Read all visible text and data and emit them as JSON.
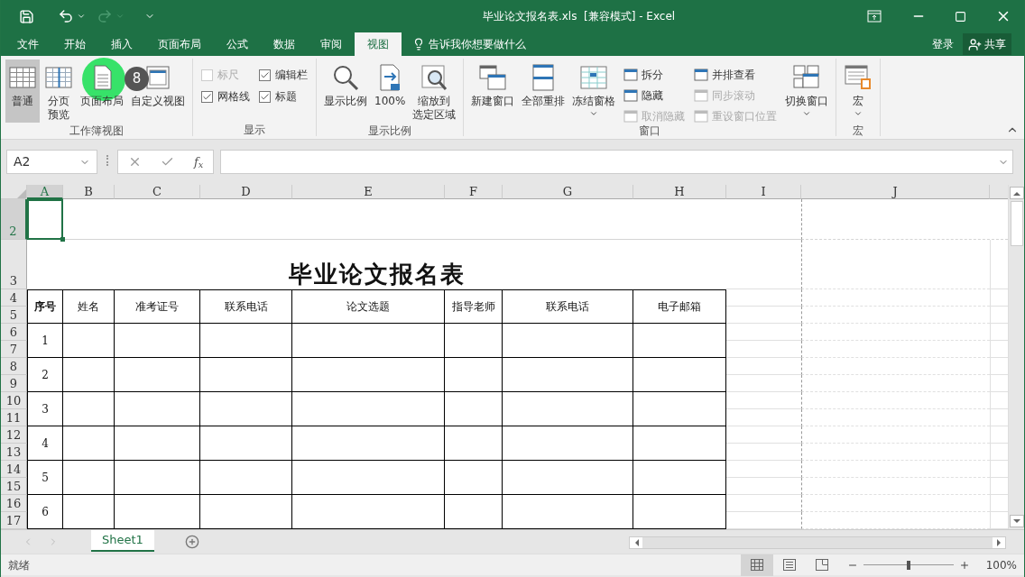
{
  "window": {
    "title": "毕业论文报名表.xls  [兼容模式] - Excel"
  },
  "tabs": [
    {
      "label": "文件",
      "selected": false
    },
    {
      "label": "开始",
      "selected": false
    },
    {
      "label": "插入",
      "selected": false
    },
    {
      "label": "页面布局",
      "selected": false
    },
    {
      "label": "公式",
      "selected": false
    },
    {
      "label": "数据",
      "selected": false
    },
    {
      "label": "审阅",
      "selected": false
    },
    {
      "label": "视图",
      "selected": true
    }
  ],
  "tell_me": "告诉我你想要做什么",
  "account": {
    "sign_in": "登录",
    "share": "共享"
  },
  "ribbon": {
    "groups": [
      {
        "name": "工作簿视图",
        "items": [
          {
            "kind": "large",
            "label": "普通",
            "selected": true
          },
          {
            "kind": "large",
            "lines": [
              "分页",
              "预览"
            ],
            "selected": false
          },
          {
            "kind": "large",
            "label": "页面布局",
            "selected": false
          },
          {
            "kind": "large",
            "label": "自定义视图",
            "selected": false
          }
        ]
      },
      {
        "name": "显示",
        "items": [
          {
            "kind": "stack",
            "items": [
              {
                "kind": "checkbox",
                "label": "标尺",
                "checked": false,
                "disabled": true
              },
              {
                "kind": "checkbox",
                "label": "网格线",
                "checked": true,
                "disabled": false
              }
            ]
          },
          {
            "kind": "stack",
            "items": [
              {
                "kind": "checkbox",
                "label": "编辑栏",
                "checked": true,
                "disabled": false
              },
              {
                "kind": "checkbox",
                "label": "标题",
                "checked": true,
                "disabled": false
              }
            ]
          }
        ]
      },
      {
        "name": "显示比例",
        "items": [
          {
            "kind": "large",
            "label": "显示比例",
            "dropdown": false
          },
          {
            "kind": "large",
            "label": "100%",
            "dropdown": false
          },
          {
            "kind": "large",
            "lines": [
              "缩放到",
              "选定区域"
            ],
            "dropdown": false
          }
        ]
      },
      {
        "name": "窗口",
        "items": [
          {
            "kind": "large",
            "label": "新建窗口",
            "dropdown": false
          },
          {
            "kind": "large",
            "label": "全部重排",
            "dropdown": false
          },
          {
            "kind": "large",
            "label": "冻结窗格",
            "dropdown": true
          },
          {
            "kind": "stack",
            "items": [
              {
                "kind": "small",
                "label": "拆分",
                "disabled": false
              },
              {
                "kind": "small",
                "label": "隐藏",
                "disabled": false
              },
              {
                "kind": "small",
                "label": "取消隐藏",
                "disabled": true
              }
            ]
          },
          {
            "kind": "stack",
            "items": [
              {
                "kind": "small",
                "label": "并排查看",
                "disabled": false
              },
              {
                "kind": "small",
                "label": "同步滚动",
                "disabled": true
              },
              {
                "kind": "small",
                "label": "重设窗口位置",
                "disabled": true
              }
            ]
          },
          {
            "kind": "large",
            "label": "切换窗口",
            "dropdown": true
          }
        ]
      },
      {
        "name": "宏",
        "items": [
          {
            "kind": "large",
            "label": "宏",
            "dropdown": true
          }
        ]
      }
    ]
  },
  "tutorial_marker": {
    "step": "8"
  },
  "formula_bar": {
    "name_box": "A2",
    "function_symbol": "f$_{x}$"
  },
  "sheet": {
    "columns": [
      {
        "label": "A",
        "selected": true
      },
      {
        "label": "B",
        "selected": false
      },
      {
        "label": "C",
        "selected": false
      },
      {
        "label": "D",
        "selected": false
      },
      {
        "label": "E",
        "selected": false
      },
      {
        "label": "F",
        "selected": false
      },
      {
        "label": "G",
        "selected": false
      },
      {
        "label": "H",
        "selected": false
      },
      {
        "label": "I",
        "selected": false
      },
      {
        "label": "J",
        "selected": false
      }
    ],
    "rows": [
      {
        "label": "2",
        "selected": true
      },
      {
        "label": "3",
        "selected": false
      },
      {
        "label": "4",
        "selected": false
      },
      {
        "label": "5",
        "selected": false
      },
      {
        "label": "6",
        "selected": false
      },
      {
        "label": "7",
        "selected": false
      },
      {
        "label": "8",
        "selected": false
      },
      {
        "label": "9",
        "selected": false
      },
      {
        "label": "10",
        "selected": false
      },
      {
        "label": "11",
        "selected": false
      },
      {
        "label": "12",
        "selected": false
      },
      {
        "label": "13",
        "selected": false
      },
      {
        "label": "14",
        "selected": false
      },
      {
        "label": "15",
        "selected": false
      },
      {
        "label": "16",
        "selected": false
      },
      {
        "label": "17",
        "selected": false
      }
    ],
    "title": "毕业论文报名表",
    "headers": [
      "序号",
      "姓名",
      "准考证号",
      "联系电话",
      "论文选题",
      "指导老师",
      "联系电话",
      "电子邮箱"
    ],
    "records": [
      "1",
      "2",
      "3",
      "4",
      "5",
      "6"
    ]
  },
  "sheet_tabs": [
    {
      "label": "Sheet1",
      "selected": true
    }
  ],
  "status_bar": {
    "text": "就绪",
    "views": [
      {
        "selected": true
      },
      {
        "selected": false
      },
      {
        "selected": false
      }
    ],
    "zoom": {
      "level": 0.5
    },
    "zoom_text": "100%"
  }
}
